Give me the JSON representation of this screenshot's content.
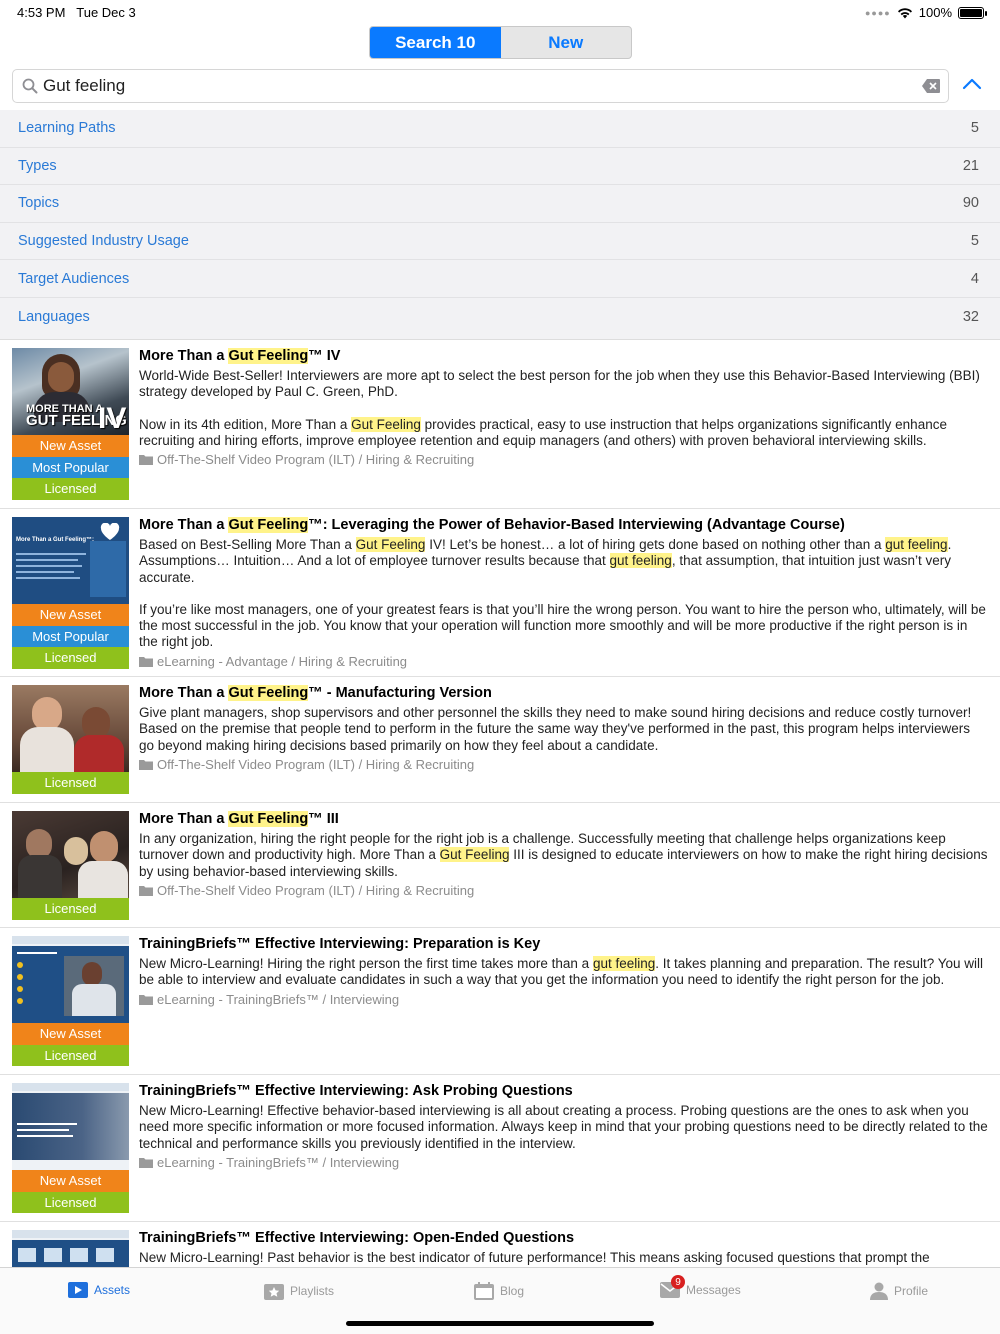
{
  "status": {
    "time": "4:53 PM",
    "date": "Tue Dec 3",
    "battery": "100%"
  },
  "segment": {
    "search": "Search 10",
    "new": "New"
  },
  "search": {
    "value": "Gut feeling"
  },
  "facets": [
    {
      "label": "Learning Paths",
      "count": "5"
    },
    {
      "label": "Types",
      "count": "21"
    },
    {
      "label": "Topics",
      "count": "90"
    },
    {
      "label": "Suggested Industry Usage",
      "count": "5"
    },
    {
      "label": "Target Audiences",
      "count": "4"
    },
    {
      "label": "Languages",
      "count": "32"
    }
  ],
  "badges": {
    "new": "New Asset",
    "popular": "Most Popular",
    "licensed": "Licensed"
  },
  "items": [
    {
      "title_pre": "More Than a ",
      "title_hl": "Gut Feeling",
      "title_post": "™ IV",
      "thumb_text1": "MORE THAN A",
      "thumb_text2": "GUT FEELING",
      "thumb_text3": "IV",
      "d1": "World-Wide Best-Seller! Interviewers are more apt to select the best person for the job when they use this Behavior-Based Interviewing (BBI) strategy developed by Paul C. Green, PhD.",
      "d2a": "Now in its 4th edition, More Than a ",
      "d2hl": "Gut Feeling",
      "d2b": " provides practical, easy to use instruction that helps organizations significantly enhance recruiting and hiring efforts, improve employee retention and equip managers (and others) with proven behavioral interviewing skills.",
      "path": "Off-The-Shelf Video Program (ILT) / Hiring & Recruiting"
    },
    {
      "title_pre": "More Than a ",
      "title_hl": "Gut Feeling",
      "title_post": "™: Leveraging the Power of Behavior-Based Interviewing (Advantage Course)",
      "thumb_text1": "More Than a Gut Feeling™:",
      "d1a": "Based on Best-Selling More Than a ",
      "d1hl": "Gut Feeling",
      "d1b": " IV! Let’s be honest… a lot of hiring gets done based on nothing other than a ",
      "d1hl2": "gut feeling",
      "d1c": ". Assumptions… Intuition… And a lot of employee turnover results because that ",
      "d1hl3": "gut feeling",
      "d1d": ", that assumption, that intuition just wasn’t very accurate.",
      "d2": "If you’re like most managers, one of your greatest fears is that you’ll hire the wrong person. You want to hire the person who, ultimately, will be the most successful in the job. You know that your operation will function more smoothly and will be more productive if the right person is in the right job.",
      "path": "eLearning - Advantage / Hiring & Recruiting"
    },
    {
      "title_pre": "More Than a ",
      "title_hl": "Gut Feeling",
      "title_post": "™ - Manufacturing Version",
      "d1": "Give plant managers, shop supervisors and other personnel the skills they need to make sound hiring decisions and reduce costly turnover! Based on the premise that people tend to perform in the future the same way they've performed in the past, this program helps interviewers go beyond making hiring decisions based primarily on how they feel about a candidate.",
      "path": "Off-The-Shelf Video Program (ILT) / Hiring & Recruiting"
    },
    {
      "title_pre": "More Than a ",
      "title_hl": "Gut Feeling",
      "title_post": "™ III",
      "d1a": "In any organization, hiring the right people for the right job is a challenge. Successfully meeting that challenge helps organizations keep turnover down and productivity high. More Than a ",
      "d1hl": "Gut Feeling",
      "d1b": " III is designed to educate interviewers on how to make the right hiring decisions by using behavior-based interviewing skills.",
      "path": "Off-The-Shelf Video Program (ILT) / Hiring & Recruiting"
    },
    {
      "title": "TrainingBriefs™ Effective Interviewing: Preparation is Key",
      "d1a": "New Micro-Learning! Hiring the right person the first time takes more than a ",
      "d1hl": "gut feeling",
      "d1b": ". It takes planning and preparation. The result? You will be able to interview and evaluate candidates in such a way that you get the information you need to identify the right person for the job.",
      "path": "eLearning - TrainingBriefs™ / Interviewing"
    },
    {
      "title": "TrainingBriefs™ Effective Interviewing: Ask Probing Questions",
      "d1": "New Micro-Learning! Effective behavior-based interviewing is all about creating a process. Probing questions are the ones to ask when you need more specific information or more focused information.  Always keep in mind that your probing questions need to be directly related to the technical and performance skills you previously identified in the interview.",
      "path": "eLearning - TrainingBriefs™ / Interviewing"
    },
    {
      "title": "TrainingBriefs™ Effective Interviewing: Open-Ended Questions",
      "d1": "New Micro-Learning! Past behavior is the best indicator of future performance! This means asking focused questions that prompt the"
    }
  ],
  "tabs": {
    "assets": "Assets",
    "playlists": "Playlists",
    "blog": "Blog",
    "messages": "Messages",
    "messages_badge": "9",
    "profile": "Profile"
  },
  "colors": {
    "accent": "#0a7aff",
    "new_asset": "#f0841a",
    "most_popular": "#2a8fd6",
    "licensed": "#8fc11c",
    "highlight": "#fff38a"
  }
}
